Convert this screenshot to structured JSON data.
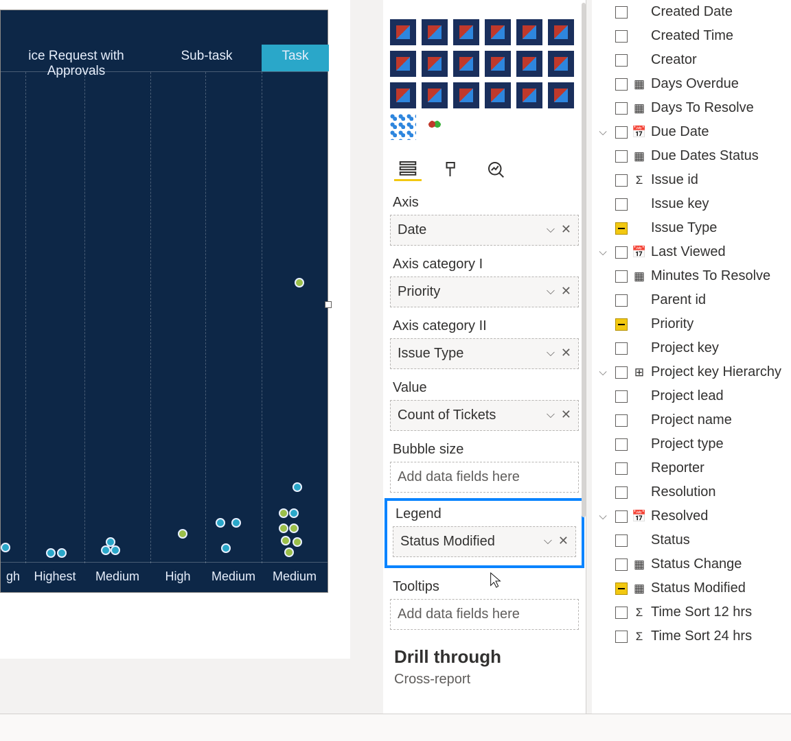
{
  "chart": {
    "columns": [
      "ice Request with Approvals",
      "Sub-task",
      "Task"
    ],
    "xlabels": [
      "gh",
      "Highest",
      "Medium",
      "High",
      "Medium",
      "Medium"
    ]
  },
  "viz": {
    "wells": {
      "axis_label": "Axis",
      "axis_value": "Date",
      "cat1_label": "Axis category I",
      "cat1_value": "Priority",
      "cat2_label": "Axis category II",
      "cat2_value": "Issue Type",
      "value_label": "Value",
      "value_value": "Count of Tickets",
      "bubble_label": "Bubble size",
      "bubble_placeholder": "Add data fields here",
      "legend_label": "Legend",
      "legend_value": "Status Modified",
      "tooltips_label": "Tooltips",
      "tooltips_placeholder": "Add data fields here"
    },
    "drill_label": "Drill through",
    "cross_label": "Cross-report"
  },
  "fields": [
    {
      "label": "Created Date",
      "checked": false,
      "icon": "",
      "expand": ""
    },
    {
      "label": "Created Time",
      "checked": false,
      "icon": "",
      "expand": ""
    },
    {
      "label": "Creator",
      "checked": false,
      "icon": "",
      "expand": ""
    },
    {
      "label": "Days Overdue",
      "checked": false,
      "icon": "table",
      "expand": ""
    },
    {
      "label": "Days To Resolve",
      "checked": false,
      "icon": "table",
      "expand": ""
    },
    {
      "label": "Due Date",
      "checked": false,
      "icon": "cal",
      "expand": "v"
    },
    {
      "label": "Due Dates Status",
      "checked": false,
      "icon": "table",
      "expand": ""
    },
    {
      "label": "Issue id",
      "checked": false,
      "icon": "sigma",
      "expand": ""
    },
    {
      "label": "Issue key",
      "checked": false,
      "icon": "",
      "expand": ""
    },
    {
      "label": "Issue Type",
      "checked": true,
      "icon": "",
      "expand": ""
    },
    {
      "label": "Last Viewed",
      "checked": false,
      "icon": "cal",
      "expand": "v"
    },
    {
      "label": "Minutes To Resolve",
      "checked": false,
      "icon": "table",
      "expand": ""
    },
    {
      "label": "Parent id",
      "checked": false,
      "icon": "",
      "expand": ""
    },
    {
      "label": "Priority",
      "checked": true,
      "icon": "",
      "expand": ""
    },
    {
      "label": "Project key",
      "checked": false,
      "icon": "",
      "expand": ""
    },
    {
      "label": "Project key Hierarchy",
      "checked": false,
      "icon": "hier",
      "expand": "v"
    },
    {
      "label": "Project lead",
      "checked": false,
      "icon": "",
      "expand": ""
    },
    {
      "label": "Project name",
      "checked": false,
      "icon": "",
      "expand": ""
    },
    {
      "label": "Project type",
      "checked": false,
      "icon": "",
      "expand": ""
    },
    {
      "label": "Reporter",
      "checked": false,
      "icon": "",
      "expand": ""
    },
    {
      "label": "Resolution",
      "checked": false,
      "icon": "",
      "expand": ""
    },
    {
      "label": "Resolved",
      "checked": false,
      "icon": "cal",
      "expand": "v"
    },
    {
      "label": "Status",
      "checked": false,
      "icon": "",
      "expand": ""
    },
    {
      "label": "Status Change",
      "checked": false,
      "icon": "table",
      "expand": ""
    },
    {
      "label": "Status Modified",
      "checked": true,
      "icon": "table",
      "expand": ""
    },
    {
      "label": "Time Sort 12 hrs",
      "checked": false,
      "icon": "sigma",
      "expand": ""
    },
    {
      "label": "Time Sort 24 hrs",
      "checked": false,
      "icon": "sigma",
      "expand": ""
    }
  ],
  "chart_data": {
    "type": "scatter",
    "note": "values are approximate pixel-read positions; y-axis scale not visible",
    "category1": "Priority",
    "category2": "Issue Type",
    "columns_visible": [
      "Service Request with Approvals (partial)",
      "Sub-task",
      "Task"
    ],
    "points": [
      {
        "cat2": "Task",
        "cat1": "",
        "y_rel": 0.6,
        "series": "g"
      },
      {
        "cat2": "Task",
        "cat1": "High",
        "y_rel": 0.04,
        "series": "c"
      },
      {
        "cat2": "Sub-task",
        "cat1": "High",
        "y_rel": 0.08,
        "series": "g"
      },
      {
        "cat2": "Sub-task",
        "cat1": "Medium",
        "y_rel": 0.03,
        "series": "c"
      },
      {
        "cat2": "Sub-task",
        "cat1": "Medium",
        "y_rel": 0.03,
        "series": "c"
      },
      {
        "cat2": "Task",
        "cat1": "Medium",
        "y_rel": 0.12,
        "series": "g"
      },
      {
        "cat2": "Task",
        "cat1": "Medium",
        "y_rel": 0.12,
        "series": "c"
      },
      {
        "cat2": "Task",
        "cat1": "Medium",
        "y_rel": 0.07,
        "series": "g"
      },
      {
        "cat2": "Task",
        "cat1": "Medium",
        "y_rel": 0.06,
        "series": "g"
      },
      {
        "cat2": "Task",
        "cat1": "Medium",
        "y_rel": 0.03,
        "series": "g"
      },
      {
        "cat2": "ice Request with Approvals",
        "cat1": "Highest",
        "y_rel": 0.02,
        "series": "c"
      },
      {
        "cat2": "ice Request with Approvals",
        "cat1": "Medium",
        "y_rel": 0.02,
        "series": "c"
      }
    ]
  }
}
